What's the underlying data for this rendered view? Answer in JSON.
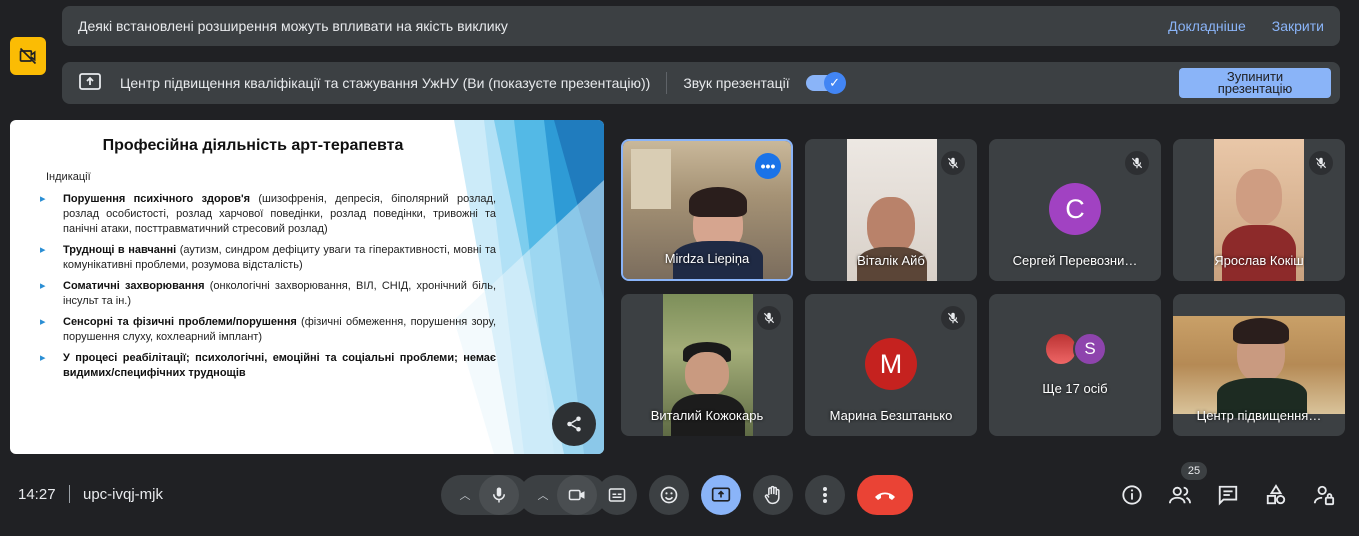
{
  "banner": {
    "message": "Деякі встановлені розширення можуть впливати на якість виклику",
    "learn_more": "Докладніше",
    "close": "Закрити"
  },
  "presentation_bar": {
    "title": "Центр підвищення кваліфікації та стажування УжНУ (Ви (показуєте презентацію))",
    "audio_label": "Звук презентації",
    "audio_enabled": true,
    "stop_button": "Зупинити презентацію"
  },
  "slide": {
    "title": "Професійна діяльність арт-терапевта",
    "subhead": "Індикації",
    "items": [
      {
        "bold": "Порушення психічного здоров'я",
        "text": " (шизофренія, депресія, біполярний розлад, розлад особистості, розлад харчової поведінки, розлад поведінки, тривожні та панічні атаки, посттравматичний стресовий розлад)"
      },
      {
        "bold": "Труднощі в навчанні",
        "text": " (аутизм, синдром дефіциту уваги та гіперактивності, мовні та комунікативні проблеми, розумова відсталість)"
      },
      {
        "bold": "Соматичні захворювання",
        "text": " (онкологічні захворювання, ВІЛ, СНІД, хронічний біль, інсульт та ін.)"
      },
      {
        "bold": "Сенсорні та фізичні проблеми/порушення",
        "text": " (фізичні обмеження, порушення зору, порушення слуху, кохлеарний імплант)"
      },
      {
        "bold": "У процесі реабілітації; психологічні, емоційні та соціальні проблеми; немає видимих/специфічних труднощів",
        "text": ""
      }
    ]
  },
  "participants": [
    {
      "name": "Mirdza Liepiņa",
      "type": "video",
      "active": true,
      "muted": false
    },
    {
      "name": "Віталік Айб",
      "type": "video",
      "muted": true
    },
    {
      "name": "Сергей Перевозни…",
      "type": "avatar",
      "letter": "С",
      "color": "#a142c2",
      "muted": true
    },
    {
      "name": "Ярослав Кокіш",
      "type": "video",
      "muted": true
    },
    {
      "name": "Виталий Кожокарь",
      "type": "video",
      "muted": true
    },
    {
      "name": "Марина Безштанько",
      "type": "avatar",
      "letter": "M",
      "color": "#c5221f",
      "muted": true
    },
    {
      "name": "Ще 17 осіб",
      "type": "others",
      "letter": "S",
      "color": "#8e44ad"
    },
    {
      "name": "Центр підвищення…",
      "type": "video",
      "muted": false
    }
  ],
  "bottom_bar": {
    "time": "14:27",
    "meeting_code": "upc-ivqj-mjk",
    "people_count": "25"
  },
  "colors": {
    "accent": "#8ab4f8",
    "end_call": "#ea4335",
    "extension_warning": "#fbbc04"
  }
}
